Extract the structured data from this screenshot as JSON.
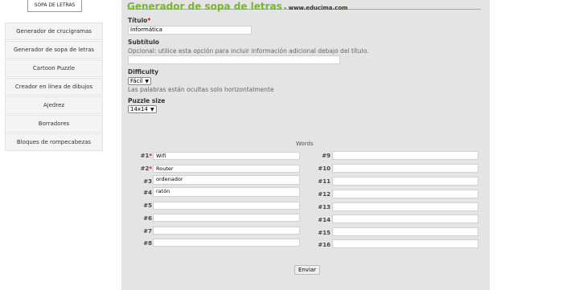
{
  "logo": {
    "text": "SOPA DE LETRAS"
  },
  "sidebar": {
    "items": [
      "Generador de crucigramas",
      "Generador de sopa de letras",
      "Cartoon Puzzle",
      "Creador en línea de dibujos",
      "Ajedrez",
      "Borradores",
      "Bloques de rompecabezas"
    ]
  },
  "header": {
    "title": "Generador de sopa de letras",
    "suffix": " - www.educima.com"
  },
  "form": {
    "title_label": "Título",
    "title_required": "*",
    "title_value": "Informática",
    "subtitle_label": "Subtítulo",
    "subtitle_hint": "Opcional: utilice esta opción para incluir información adicional debajo del título.",
    "subtitle_value": "",
    "difficulty_label": "Difficulty",
    "difficulty_value": "Fácil",
    "difficulty_hint": "Las palabras están ocultas solo horizontalmente",
    "size_label": "Puzzle size",
    "size_value": "14x14",
    "submit_label": "Enviar"
  },
  "words": {
    "title": "Words",
    "left": [
      {
        "num": "#1",
        "req": "*",
        "value": "Wifi"
      },
      {
        "num": "#2",
        "req": "*",
        "value": "Router"
      },
      {
        "num": "#3",
        "req": "",
        "value": "ordenador"
      },
      {
        "num": "#4",
        "req": "",
        "value": "ratón"
      },
      {
        "num": "#5",
        "req": "",
        "value": ""
      },
      {
        "num": "#6",
        "req": "",
        "value": ""
      },
      {
        "num": "#7",
        "req": "",
        "value": ""
      },
      {
        "num": "#8",
        "req": "",
        "value": ""
      }
    ],
    "right": [
      {
        "num": "#9",
        "value": ""
      },
      {
        "num": "#10",
        "value": ""
      },
      {
        "num": "#11",
        "value": ""
      },
      {
        "num": "#12",
        "value": ""
      },
      {
        "num": "#13",
        "value": ""
      },
      {
        "num": "#14",
        "value": ""
      },
      {
        "num": "#15",
        "value": ""
      },
      {
        "num": "#16",
        "value": ""
      }
    ]
  }
}
